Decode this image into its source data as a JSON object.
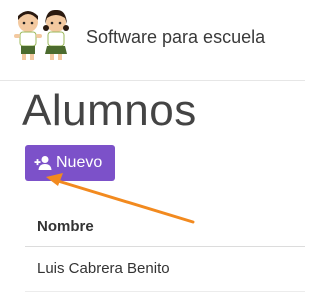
{
  "header": {
    "title": "Software para escuela",
    "logo_icon": "children-mascot-icon"
  },
  "page": {
    "title": "Alumnos"
  },
  "actions": {
    "new_label": "Nuevo",
    "new_icon": "add-user-icon",
    "button_color": "#7c51c9"
  },
  "table": {
    "columns": [
      "Nombre"
    ],
    "rows": [
      [
        "Luis Cabrera Benito"
      ]
    ]
  },
  "annotation": {
    "arrow_color": "#f28a1f",
    "arrow_icon": "arrow-pointer-icon"
  }
}
